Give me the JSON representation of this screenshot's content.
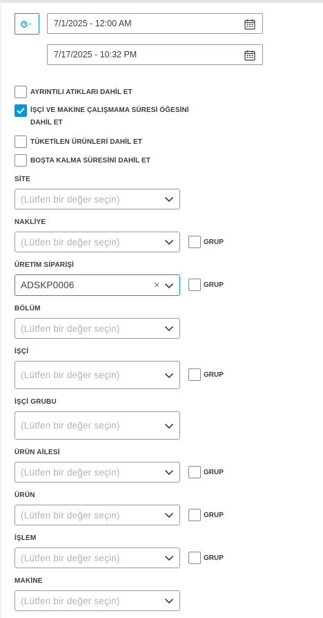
{
  "time_range": {
    "start": "7/1/2025 - 12:00 AM",
    "end": "7/17/2025 - 10:32 PM"
  },
  "options": [
    {
      "label": "AYRINTILI ATIKLARI DAHİL ET",
      "checked": false
    },
    {
      "label": "İŞÇİ VE MAKİNE ÇALIŞMAMA SÜRESİ ÖĞESİNİ DAHİL ET",
      "checked": true
    },
    {
      "label": "TÜKETİLEN ÜRÜNLERİ DAHİL ET",
      "checked": false
    },
    {
      "label": "BOŞTA KALMA SÜRESİNİ DAHİL ET",
      "checked": false
    }
  ],
  "group_label": "GRUP",
  "placeholder": "(Lütfen bir değer seçin)",
  "filters": {
    "site": {
      "label": "SİTE"
    },
    "nakliye": {
      "label": "NAKLİYE"
    },
    "uretim_siparisi": {
      "label": "ÜRETİM SİPARİŞİ",
      "value": "ADSKP0006"
    },
    "bolum": {
      "label": "BÖLÜM"
    },
    "isci": {
      "label": "İŞÇİ"
    },
    "isci_grubu": {
      "label": "İŞÇİ GRUBU"
    },
    "urun_ailesi": {
      "label": "ÜRÜN AİLESİ"
    },
    "urun": {
      "label": "ÜRÜN"
    },
    "islem": {
      "label": "İŞLEM"
    },
    "makine": {
      "label": "MAKİNE"
    }
  },
  "colors": {
    "accent": "#0696d7",
    "border": "#9a9a9a",
    "placeholder": "#b3b3b3"
  }
}
